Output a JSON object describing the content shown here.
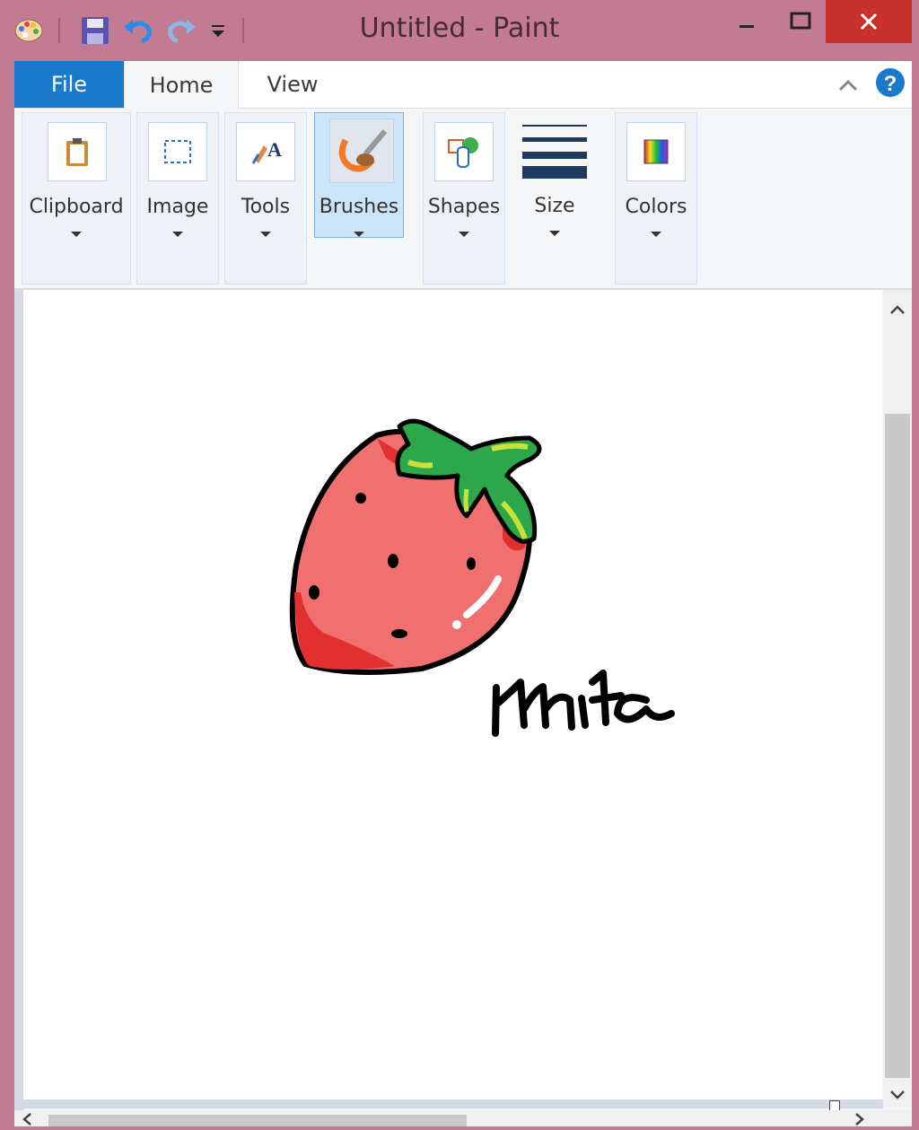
{
  "window": {
    "title": "Untitled - Paint"
  },
  "quick_access": {
    "icons": [
      "paint-app-icon",
      "save-icon",
      "undo-icon",
      "redo-icon",
      "customize-icon"
    ]
  },
  "tabs": [
    {
      "label": "File"
    },
    {
      "label": "Home"
    },
    {
      "label": "View"
    }
  ],
  "ribbon": {
    "groups": [
      {
        "label": "Clipboard",
        "icon": "clipboard-icon"
      },
      {
        "label": "Image",
        "icon": "select-icon"
      },
      {
        "label": "Tools",
        "icon": "tools-icon"
      },
      {
        "label": "Brushes",
        "icon": "brush-icon",
        "selected": true
      },
      {
        "label": "Shapes",
        "icon": "shapes-icon"
      },
      {
        "label": "Size",
        "icon": "size-icon"
      },
      {
        "label": "Colors",
        "icon": "colors-icon"
      }
    ]
  },
  "canvas": {
    "drawing": "strawberry",
    "signature": "Mhita"
  },
  "colors": {
    "title_bar": "#c27b93",
    "close_button": "#c7302b",
    "file_tab": "#1979ca",
    "selected_group": "#cce4f7"
  }
}
